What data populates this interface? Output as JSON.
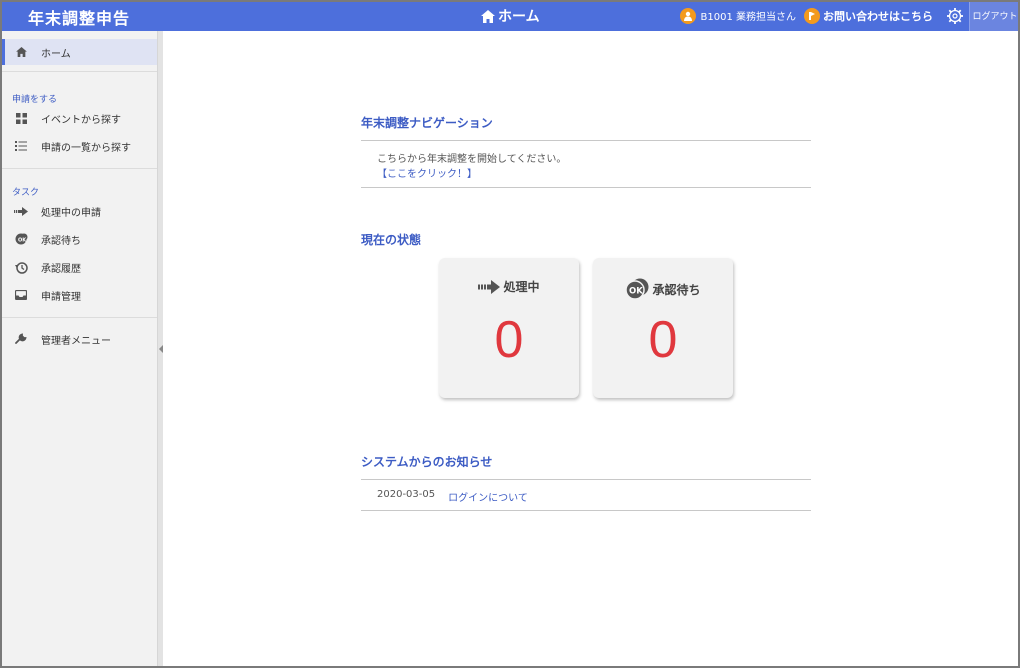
{
  "header": {
    "app_title": "年末調整申告",
    "page_title": "ホーム",
    "user_label": "B1001 業務担当さん",
    "contact_label": "お問い合わせはこちら",
    "logout_label": "ログアウト",
    "accent_color": "#4d6fdc"
  },
  "sidebar": {
    "home_label": "ホーム",
    "section_apply": "申請をする",
    "apply_items": [
      {
        "label": "イベントから探す",
        "icon": "grid-icon"
      },
      {
        "label": "申請の一覧から探す",
        "icon": "list-icon"
      }
    ],
    "section_task": "タスク",
    "task_items": [
      {
        "label": "処理中の申請",
        "icon": "arrow-right-icon"
      },
      {
        "label": "承認待ち",
        "icon": "ok-badge-icon"
      },
      {
        "label": "承認履歴",
        "icon": "history-icon"
      },
      {
        "label": "申請管理",
        "icon": "inbox-icon"
      }
    ],
    "admin_label": "管理者メニュー"
  },
  "main": {
    "navigation": {
      "title": "年末調整ナビゲーション",
      "text": "こちらから年末調整を開始してください。",
      "link": "【ここをクリック！】"
    },
    "status": {
      "title": "現在の状態",
      "cards": [
        {
          "label": "処理中",
          "count": "0"
        },
        {
          "label": "承認待ち",
          "count": "0"
        }
      ]
    },
    "notices": {
      "title": "システムからのお知らせ",
      "items": [
        {
          "date": "2020-03-05",
          "text": "ログインについて"
        }
      ]
    }
  }
}
